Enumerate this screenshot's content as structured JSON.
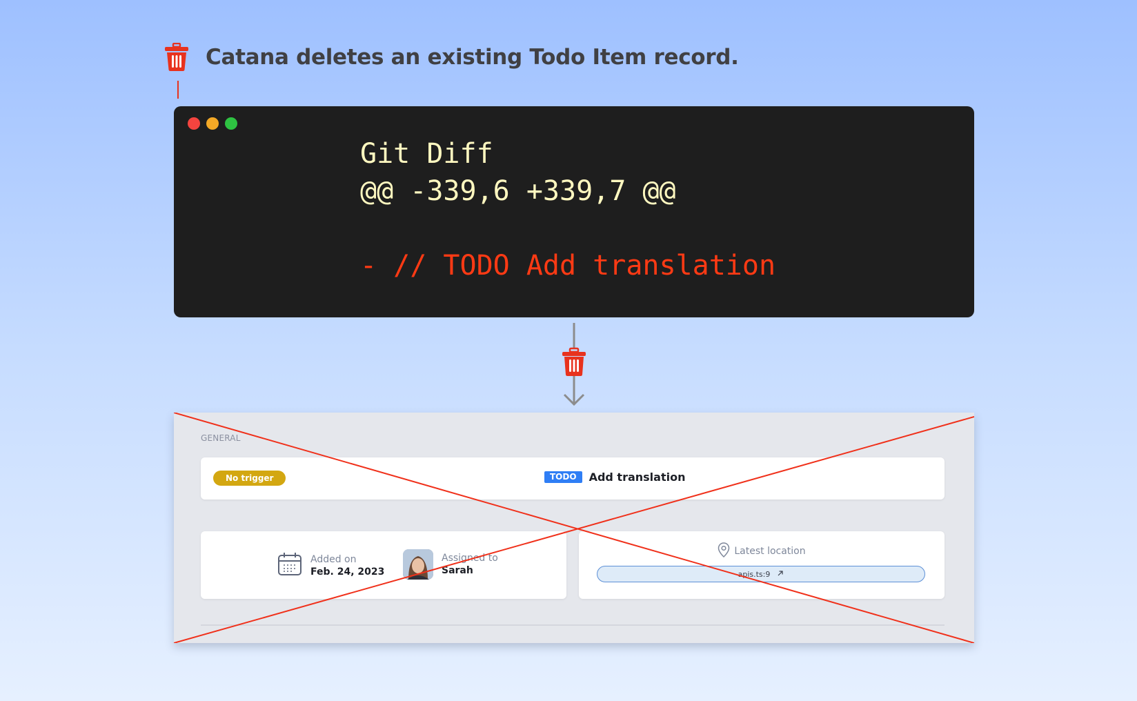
{
  "headline": {
    "text": "Catana deletes an existing Todo Item record."
  },
  "terminal": {
    "title_line": "Git Diff",
    "hunk_header": "@@ -339,6 +339,7 @@",
    "removed_line": "- // TODO Add translation"
  },
  "todo_card": {
    "section_label": "GENERAL",
    "trigger_badge": "No trigger",
    "type_badge": "TODO",
    "title": "Add translation",
    "added_on_label": "Added on",
    "added_on_value": "Feb. 24, 2023",
    "assigned_to_label": "Assigned to",
    "assigned_to_value": "Sarah",
    "location_label": "Latest location",
    "location_value": "apis.ts:9"
  },
  "colors": {
    "delete_red": "#e8321e",
    "terminal_bg": "#1e1e1e",
    "code_text": "#fff8c0",
    "removed_text": "#ff3a14",
    "trigger_badge": "#d3a711",
    "todo_badge": "#2f7ef5"
  },
  "icons": [
    "trash-icon",
    "calendar-icon",
    "location-pin-icon",
    "external-link-icon",
    "arrow-down-icon"
  ]
}
